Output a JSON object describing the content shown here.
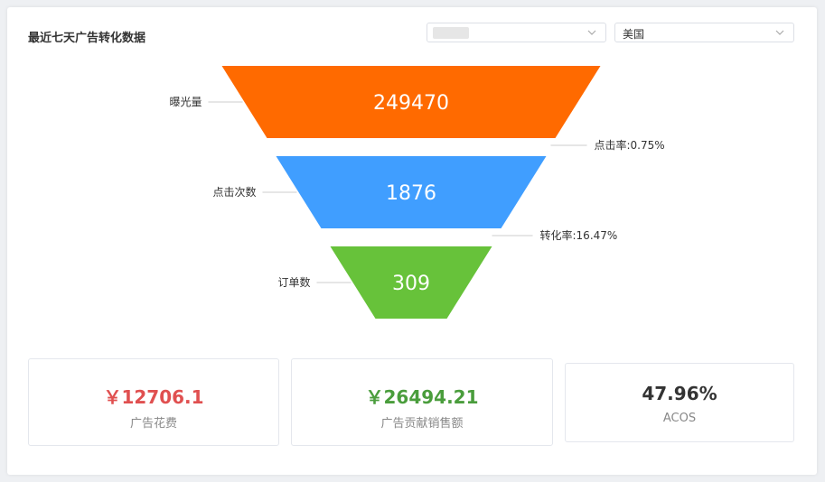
{
  "header": {
    "title": "最近七天广告转化数据",
    "store_select": {
      "value": ""
    },
    "country_select": {
      "value": "美国"
    }
  },
  "chart_data": {
    "type": "funnel",
    "stages": [
      {
        "name": "曝光量",
        "value": 249470,
        "color": "#ff6a00"
      },
      {
        "name": "点击次数",
        "value": 1876,
        "color": "#409eff"
      },
      {
        "name": "订单数",
        "value": 309,
        "color": "#67c23a"
      }
    ],
    "rates": [
      {
        "label": "点击率:0.75%"
      },
      {
        "label": "转化率:16.47%"
      }
    ]
  },
  "stats": [
    {
      "value": "￥12706.1",
      "label": "广告花费",
      "color": "#e05050"
    },
    {
      "value": "￥26494.21",
      "label": "广告贡献销售额",
      "color": "#4a9d3c"
    },
    {
      "value": "47.96%",
      "label": "ACOS",
      "color": "#333333"
    }
  ]
}
